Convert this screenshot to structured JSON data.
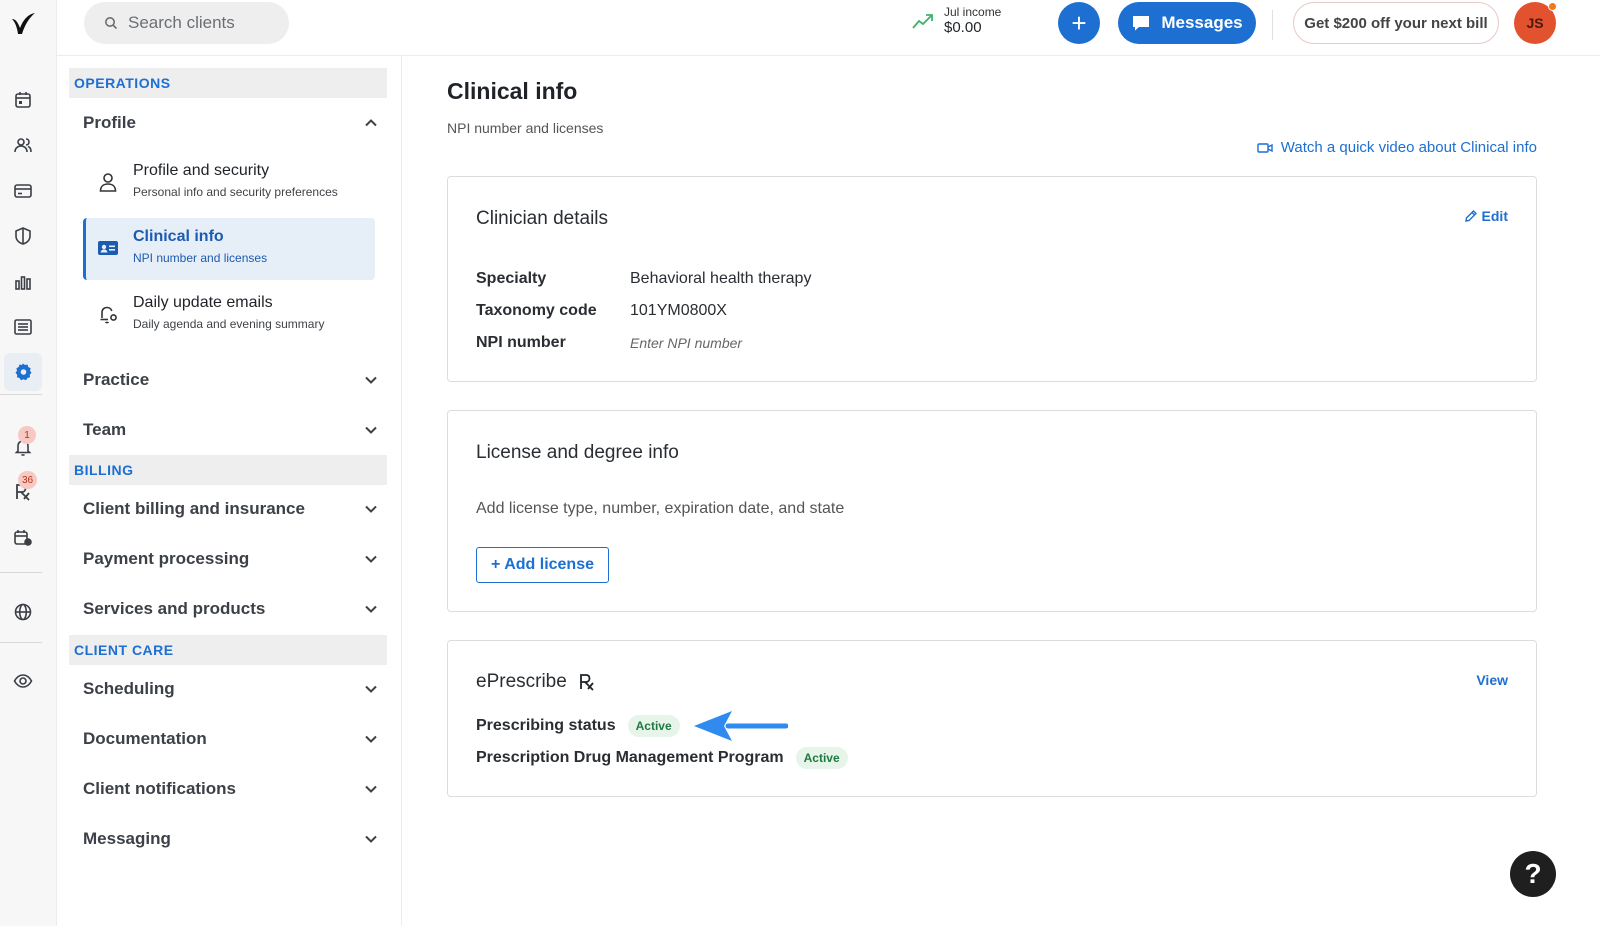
{
  "rail": {
    "badges": {
      "notifications": "1",
      "prescriptions": "36"
    }
  },
  "topbar": {
    "search_placeholder": "Search clients",
    "income_label": "Jul income",
    "income_value": "$0.00",
    "plus_label": "+",
    "messages_label": "Messages",
    "promo_label": "Get $200 off your next bill",
    "avatar_initials": "JS"
  },
  "sidebar": {
    "sections": {
      "operations": "OPERATIONS",
      "billing": "BILLING",
      "client_care": "CLIENT CARE"
    },
    "profile": {
      "label": "Profile",
      "items": [
        {
          "title": "Profile and security",
          "subtitle": "Personal info and security preferences"
        },
        {
          "title": "Clinical info",
          "subtitle": "NPI number and licenses"
        },
        {
          "title": "Daily update emails",
          "subtitle": "Daily agenda and evening summary"
        }
      ]
    },
    "practice": "Practice",
    "team": "Team",
    "client_billing": "Client billing and insurance",
    "payment_processing": "Payment processing",
    "services_products": "Services and products",
    "scheduling": "Scheduling",
    "documentation": "Documentation",
    "client_notifications": "Client notifications",
    "messaging": "Messaging"
  },
  "main": {
    "title": "Clinical info",
    "subtitle": "NPI number and licenses",
    "video_link": "Watch a quick video about Clinical info",
    "clinician": {
      "title": "Clinician details",
      "edit_label": "Edit",
      "rows": [
        {
          "label": "Specialty",
          "value": "Behavioral health therapy"
        },
        {
          "label": "Taxonomy code",
          "value": "101YM0800X"
        },
        {
          "label": "NPI number",
          "value": "Enter NPI number"
        }
      ]
    },
    "license": {
      "title": "License and degree info",
      "description": "Add license type, number, expiration date, and state",
      "add_label": "+ Add license"
    },
    "eprescribe": {
      "title": "ePrescribe",
      "view_label": "View",
      "rows": [
        {
          "label": "Prescribing status",
          "status": "Active"
        },
        {
          "label": "Prescription Drug Management Program",
          "status": "Active"
        }
      ]
    }
  },
  "help_label": "?",
  "colors": {
    "accent": "#1d6fd1",
    "active_badge_bg": "#e6f4ea",
    "active_badge_text": "#1f7a3f",
    "arrow": "#2f8bf0"
  }
}
